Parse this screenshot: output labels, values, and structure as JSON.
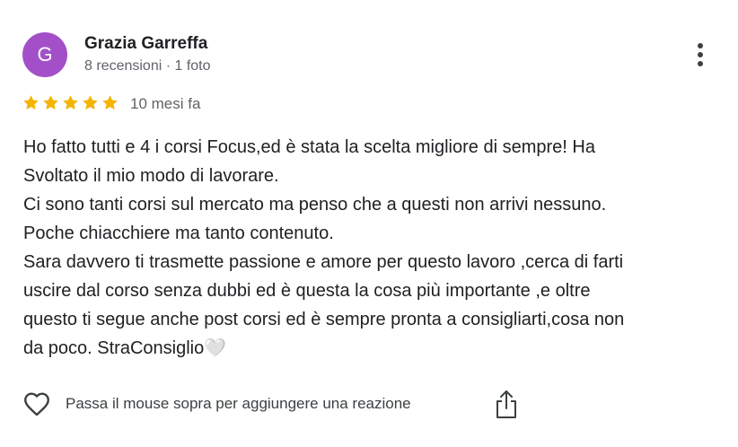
{
  "author": {
    "initial": "G",
    "avatar_color": "#a350c8",
    "name": "Grazia Garreffa",
    "meta": "8 recensioni · 1 foto"
  },
  "rating": {
    "stars": 5,
    "max_stars": 5,
    "star_color": "#f4b400"
  },
  "date": "10 mesi fa",
  "review_lines": [
    "Ho fatto tutti e 4 i corsi Focus,ed è stata la scelta migliore di sempre! Ha",
    "Svoltato il mio modo di lavorare.",
    "Ci sono tanti corsi sul mercato ma penso che a questi non arrivi nessuno.",
    "Poche chiacchiere ma tanto contenuto.",
    "Sara davvero ti trasmette passione e amore per questo lavoro ,cerca di farti",
    "uscire dal corso senza dubbi ed è questa la cosa più importante ,e oltre",
    "questo ti segue anche post corsi ed è sempre pronta a consigliarti,cosa non",
    "da poco. StraConsiglio🤍"
  ],
  "actions": {
    "like_icon": "heart-outline-icon",
    "reaction_hint": "Passa il mouse sopra per aggiungere una reazione",
    "share_icon": "share-icon",
    "more_icon": "more-vertical-icon"
  }
}
